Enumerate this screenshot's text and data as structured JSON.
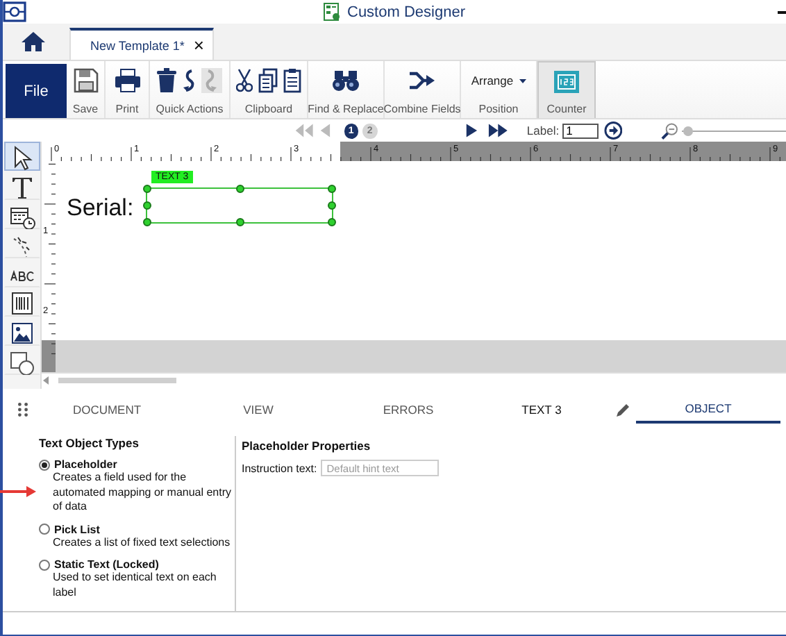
{
  "window": {
    "title": "Custom Designer"
  },
  "tabs": [
    {
      "label": "New Template 1*",
      "selected": true,
      "close": "×"
    }
  ],
  "ribbon": {
    "file_button": "File",
    "groups": [
      {
        "kind": "save",
        "label": "Save",
        "selected": false
      },
      {
        "kind": "print",
        "label": "Print",
        "selected": false
      },
      {
        "kind": "quick",
        "label": "Quick Actions",
        "selected": false
      },
      {
        "kind": "clipboard",
        "label": "Clipboard",
        "selected": false
      },
      {
        "kind": "find",
        "label": "Find & Replace",
        "selected": false
      },
      {
        "kind": "combine",
        "label": "Combine Fields",
        "selected": false
      },
      {
        "kind": "position",
        "label": "Position",
        "selected": false,
        "dropdown": "Arrange"
      },
      {
        "kind": "counter",
        "label": "Counter",
        "selected": true
      }
    ]
  },
  "navigation": {
    "arrows": [
      {
        "kind": "first",
        "disabled": true
      },
      {
        "kind": "previous",
        "disabled": true
      },
      {
        "kind": "next",
        "disabled": false
      },
      {
        "kind": "last",
        "disabled": false
      }
    ],
    "pages": [
      {
        "label": "1",
        "selected": true
      },
      {
        "label": "2",
        "selected": false
      }
    ],
    "label_field": {
      "label": "Label:",
      "value": "1"
    },
    "zoom": {
      "level": 0.05
    }
  },
  "toolbox": [
    {
      "kind": "pointer",
      "selected": true
    },
    {
      "kind": "text",
      "selected": false
    },
    {
      "kind": "date",
      "selected": false
    },
    {
      "kind": "arc-text",
      "selected": false
    },
    {
      "kind": "abc",
      "selected": false
    },
    {
      "kind": "barcode",
      "selected": false
    },
    {
      "kind": "image",
      "selected": false
    },
    {
      "kind": "shape",
      "selected": false
    }
  ],
  "ruler": {
    "top_labels": [
      "0",
      "1",
      "2",
      "3",
      "4",
      "5",
      "6",
      "7",
      "8",
      "9"
    ],
    "side_labels": [
      "1",
      "2"
    ]
  },
  "canvas": {
    "items": [
      {
        "kind": "label",
        "text": "Serial:"
      },
      {
        "kind": "field",
        "tag": "TEXT 3",
        "selected": true
      }
    ]
  },
  "bottom_tabs": [
    {
      "label": "DOCUMENT",
      "selected": false,
      "editable": false
    },
    {
      "label": "VIEW",
      "selected": false,
      "editable": false
    },
    {
      "label": "ERRORS",
      "selected": false,
      "editable": false
    },
    {
      "label": "TEXT 3",
      "selected": false,
      "editable": true
    },
    {
      "label": "OBJECT",
      "selected": true,
      "editable": false
    }
  ],
  "object_panel": {
    "heading": "Text Object Types",
    "options": [
      {
        "label": "Placeholder",
        "description": "Creates a field used for the automated mapping or manual entry of data",
        "selected": true
      },
      {
        "label": "Pick List",
        "description": "Creates a list of fixed text selections",
        "selected": false
      },
      {
        "label": "Static Text (Locked)",
        "description": "Used to set identical text on each label",
        "selected": false
      }
    ]
  },
  "properties_panel": {
    "heading": "Placeholder Properties",
    "field": {
      "label": "Instruction text:",
      "placeholder": "Default hint text"
    }
  }
}
